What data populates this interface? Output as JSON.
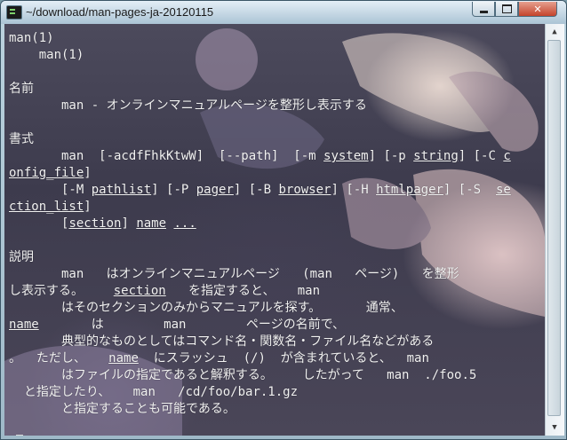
{
  "window": {
    "title": "~/download/man-pages-ja-20120115"
  },
  "controls": {
    "minimize": "minimize",
    "maximize": "maximize",
    "close": "✕"
  },
  "terminal": {
    "lines": [
      [
        {
          "t": "man(1)"
        }
      ],
      [
        {
          "t": "    man(1)"
        }
      ],
      [
        {
          "t": ""
        }
      ],
      [
        {
          "t": "名前"
        }
      ],
      [
        {
          "t": "       man - オンラインマニュアルページを整形し表示する"
        }
      ],
      [
        {
          "t": ""
        }
      ],
      [
        {
          "t": "書式"
        }
      ],
      [
        {
          "t": "       man  [-acdfFhkKtwW]  [--path]  [-m "
        },
        {
          "t": "system",
          "u": true
        },
        {
          "t": "] [-p "
        },
        {
          "t": "string",
          "u": true
        },
        {
          "t": "] [-C "
        },
        {
          "t": "c",
          "u": true
        }
      ],
      [
        {
          "t": "onfig_file",
          "u": true
        },
        {
          "t": "]"
        }
      ],
      [
        {
          "t": "       [-M "
        },
        {
          "t": "pathlist",
          "u": true
        },
        {
          "t": "] [-P "
        },
        {
          "t": "pager",
          "u": true
        },
        {
          "t": "] [-B "
        },
        {
          "t": "browser",
          "u": true
        },
        {
          "t": "] [-H "
        },
        {
          "t": "htmlpager",
          "u": true
        },
        {
          "t": "] [-S  "
        },
        {
          "t": "se",
          "u": true
        }
      ],
      [
        {
          "t": "ction_list",
          "u": true
        },
        {
          "t": "]"
        }
      ],
      [
        {
          "t": "       ["
        },
        {
          "t": "section",
          "u": true
        },
        {
          "t": "] "
        },
        {
          "t": "name",
          "u": true
        },
        {
          "t": " "
        },
        {
          "t": "...",
          "u": true
        }
      ],
      [
        {
          "t": ""
        }
      ],
      [
        {
          "t": "説明"
        }
      ],
      [
        {
          "t": "       man   はオンラインマニュアルページ   (man   ページ)   を整形"
        }
      ],
      [
        {
          "t": "し表示する。    "
        },
        {
          "t": "section",
          "u": true
        },
        {
          "t": "   を指定すると、   man"
        }
      ],
      [
        {
          "t": "       はそのセクションのみからマニュアルを探す。      通常、"
        }
      ],
      [
        {
          "t": "name",
          "u": true
        },
        {
          "t": "       は        man        ページの名前で、"
        }
      ],
      [
        {
          "t": "       典型的なものとしてはコマンド名・関数名・ファイル名などがある"
        }
      ],
      [
        {
          "t": "。  ただし、   "
        },
        {
          "t": "name",
          "u": true
        },
        {
          "t": "  にスラッシュ  (/)  が含まれていると、  man"
        }
      ],
      [
        {
          "t": "       はファイルの指定であると解釈する。    したがって   man  ./foo.5"
        }
      ],
      [
        {
          "t": "  と指定したり、   man   /cd/foo/bar.1.gz"
        }
      ],
      [
        {
          "t": "       と指定することも可能である。"
        }
      ],
      [
        {
          "t": ""
        }
      ],
      [
        {
          "t": ":"
        }
      ]
    ]
  },
  "scrollbar": {
    "up_icon": "▲",
    "down_icon": "▼"
  }
}
